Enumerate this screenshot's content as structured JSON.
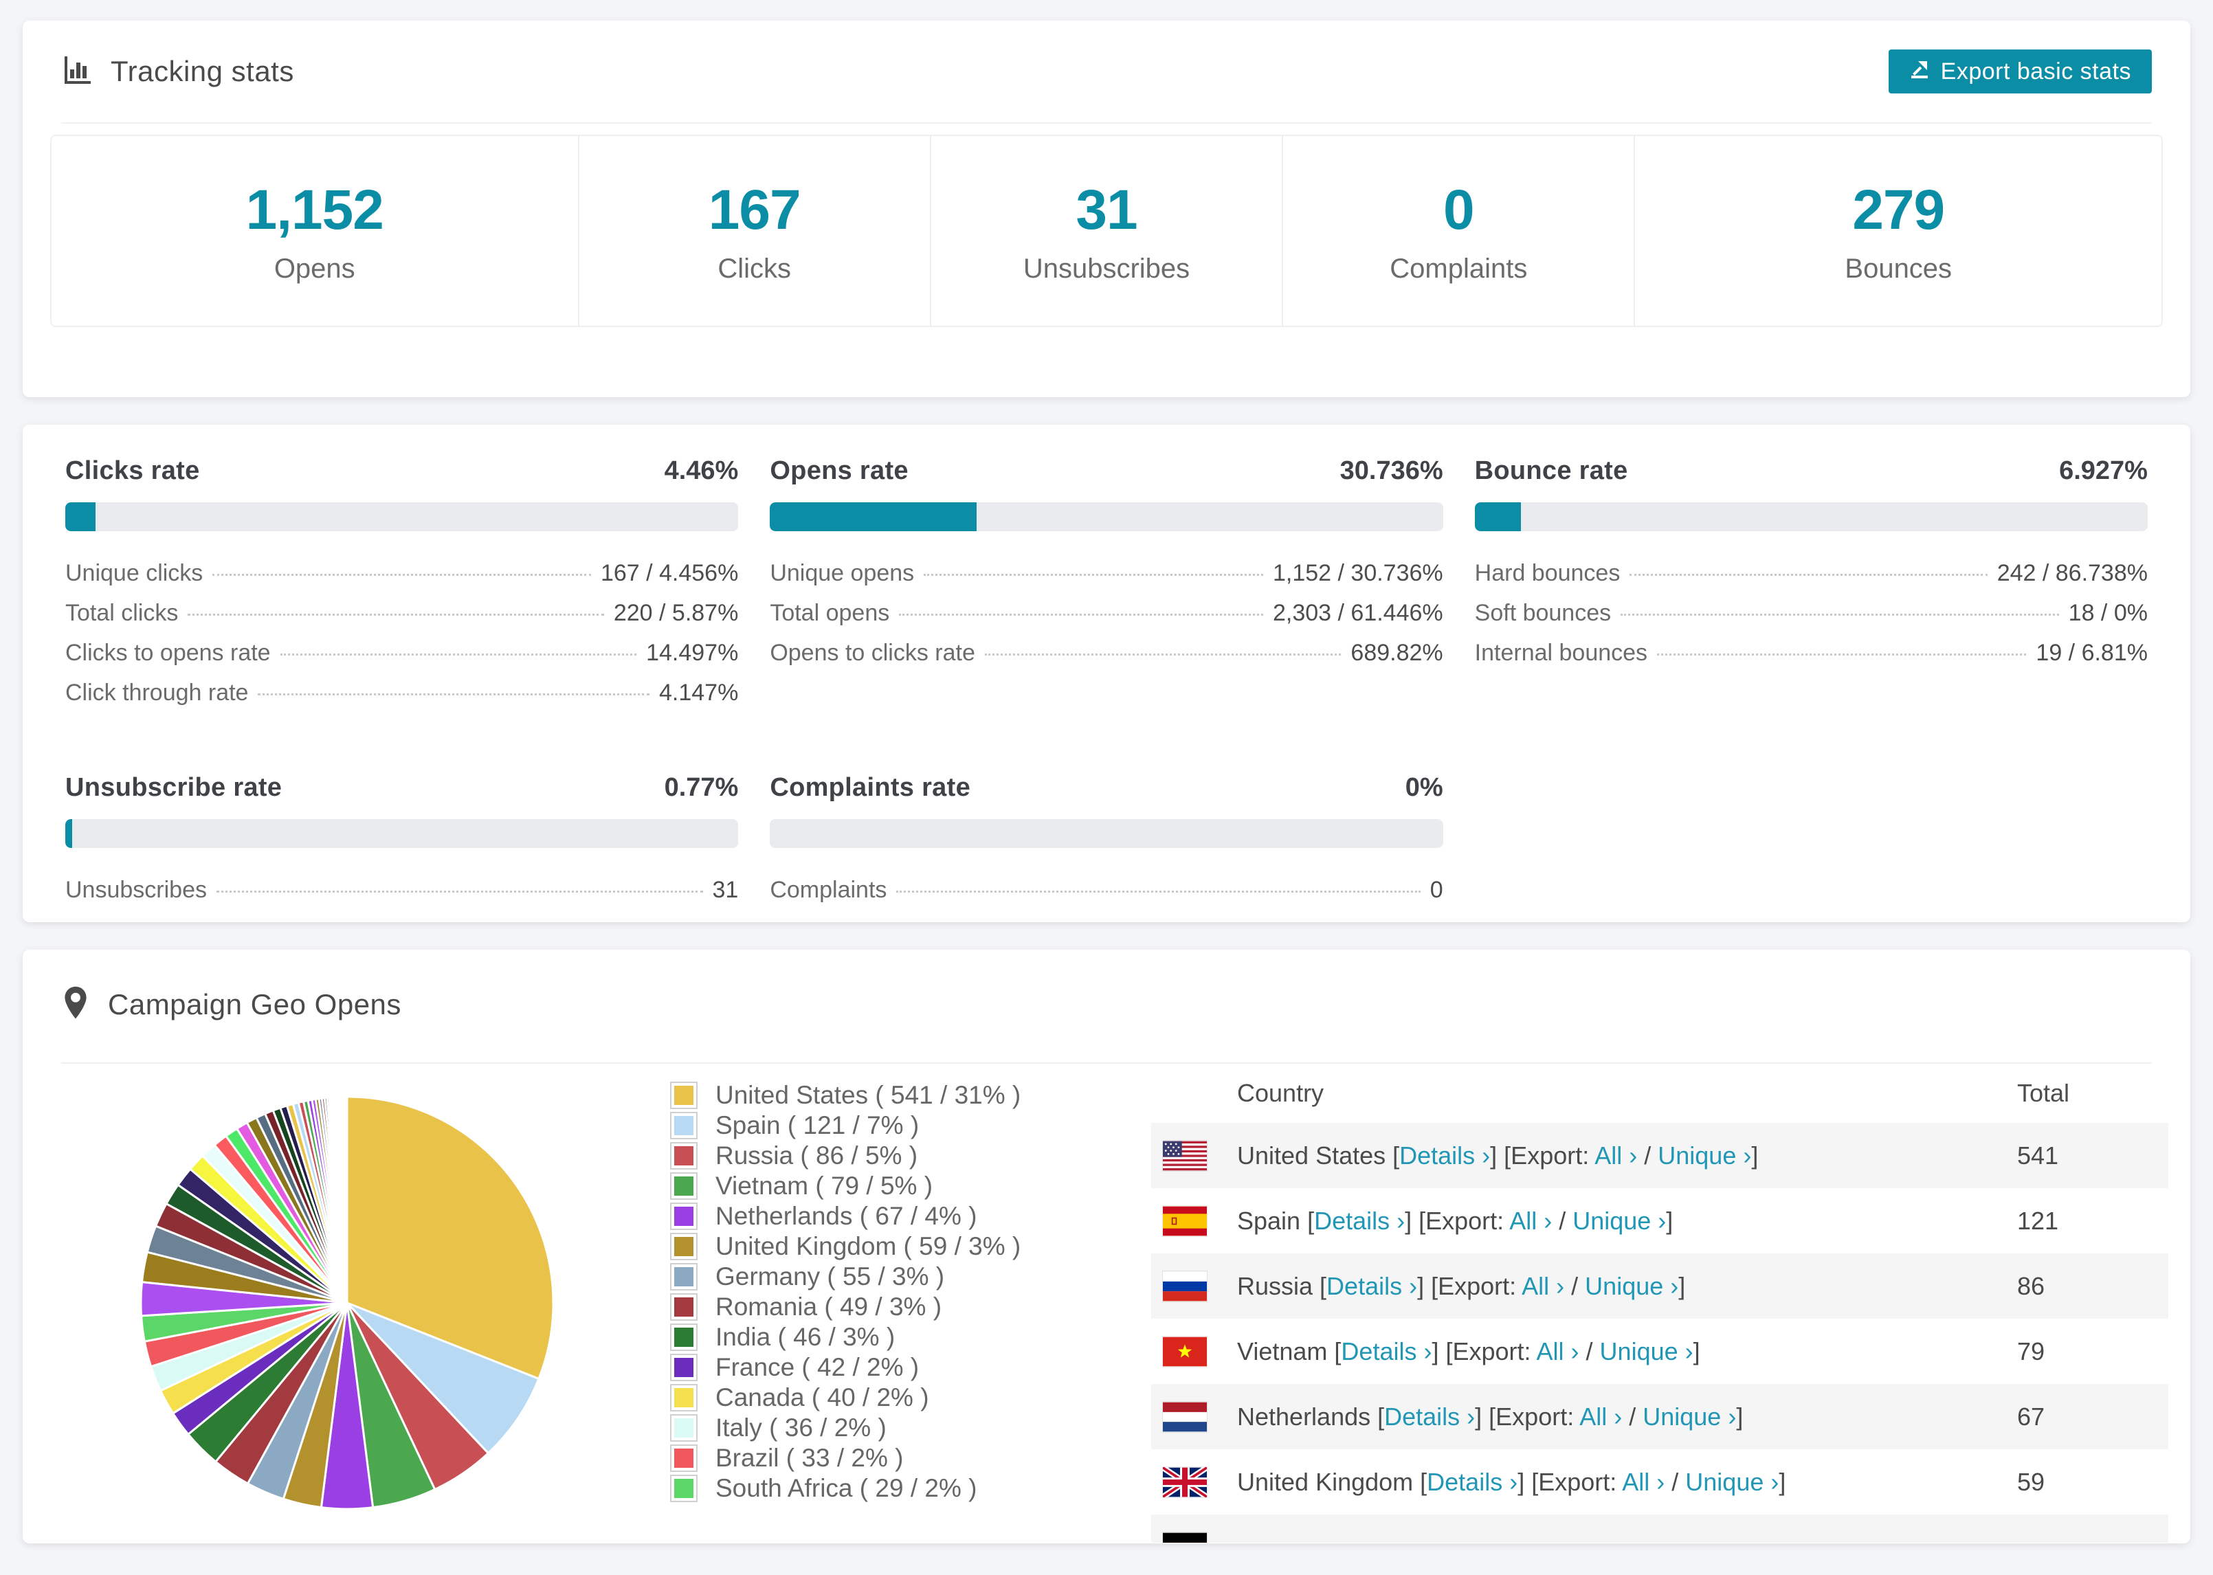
{
  "accent": "#0b8da6",
  "link_color": "#2196b5",
  "header": {
    "title": "Tracking stats",
    "icon": "bar-chart-icon",
    "export_label": "Export basic stats",
    "export_icon": "export-icon"
  },
  "summary": [
    {
      "value": "1,152",
      "label": "Opens"
    },
    {
      "value": "167",
      "label": "Clicks"
    },
    {
      "value": "31",
      "label": "Unsubscribes"
    },
    {
      "value": "0",
      "label": "Complaints"
    },
    {
      "value": "279",
      "label": "Bounces"
    }
  ],
  "rates": {
    "top": [
      {
        "title": "Clicks rate",
        "value": "4.46%",
        "percent": 4.46,
        "rows": [
          {
            "label": "Unique clicks",
            "value": "167 / 4.456%"
          },
          {
            "label": "Total clicks",
            "value": "220 / 5.87%"
          },
          {
            "label": "Clicks to opens rate",
            "value": "14.497%"
          },
          {
            "label": "Click through rate",
            "value": "4.147%"
          }
        ]
      },
      {
        "title": "Opens rate",
        "value": "30.736%",
        "percent": 30.736,
        "rows": [
          {
            "label": "Unique opens",
            "value": "1,152 / 30.736%"
          },
          {
            "label": "Total opens",
            "value": "2,303 / 61.446%"
          },
          {
            "label": "Opens to clicks rate",
            "value": "689.82%"
          }
        ]
      },
      {
        "title": "Bounce rate",
        "value": "6.927%",
        "percent": 6.927,
        "rows": [
          {
            "label": "Hard bounces",
            "value": "242 / 86.738%"
          },
          {
            "label": "Soft bounces",
            "value": "18 / 0%"
          },
          {
            "label": "Internal bounces",
            "value": "19 / 6.81%"
          }
        ]
      }
    ],
    "bottom": [
      {
        "title": "Unsubscribe rate",
        "value": "0.77%",
        "percent": 0.77,
        "rows": [
          {
            "label": "Unsubscribes",
            "value": "31"
          }
        ]
      },
      {
        "title": "Complaints rate",
        "value": "0%",
        "percent": 0,
        "rows": [
          {
            "label": "Complaints",
            "value": "0"
          }
        ]
      }
    ]
  },
  "chart_data": {
    "type": "pie",
    "title": "Campaign Geo Opens",
    "unit": "opens",
    "legend_position": "right",
    "start_angle": "top-clockwise",
    "slices": [
      {
        "label": "United States",
        "value": 541,
        "percent": 31,
        "color": "#e9c24a"
      },
      {
        "label": "Spain",
        "value": 121,
        "percent": 7,
        "color": "#b7d9f3"
      },
      {
        "label": "Russia",
        "value": 86,
        "percent": 5,
        "color": "#c84f54"
      },
      {
        "label": "Vietnam",
        "value": 79,
        "percent": 5,
        "color": "#4ba84f"
      },
      {
        "label": "Netherlands",
        "value": 67,
        "percent": 4,
        "color": "#9a3fe3"
      },
      {
        "label": "United Kingdom",
        "value": 59,
        "percent": 3,
        "color": "#b3922e"
      },
      {
        "label": "Germany",
        "value": 55,
        "percent": 3,
        "color": "#8ca9c4"
      },
      {
        "label": "Romania",
        "value": 49,
        "percent": 3,
        "color": "#a23a40"
      },
      {
        "label": "India",
        "value": 46,
        "percent": 3,
        "color": "#2c7c34"
      },
      {
        "label": "France",
        "value": 42,
        "percent": 2,
        "color": "#6a2dbd"
      },
      {
        "label": "Canada",
        "value": 40,
        "percent": 2,
        "color": "#f6df4d"
      },
      {
        "label": "Italy",
        "value": 36,
        "percent": 2,
        "color": "#dafaf6"
      },
      {
        "label": "Brazil",
        "value": 33,
        "percent": 2,
        "color": "#f1585d"
      },
      {
        "label": "South Africa",
        "value": 29,
        "percent": 2,
        "color": "#5ad766"
      }
    ],
    "others": {
      "percent": 26,
      "count": 50,
      "ratio": 0.9,
      "colors": [
        "#ab4ff0",
        "#9b7d1e",
        "#6e8296",
        "#8e2f36",
        "#1d5c2a",
        "#332565",
        "#f7f63e",
        "#e8fdfc",
        "#fb5a5f",
        "#4ee868",
        "#e35be0",
        "#8a761d",
        "#566d82",
        "#772329",
        "#16441f",
        "#251d4c",
        "#e9c24a",
        "#b7d9f3",
        "#c84f54",
        "#4ba84f",
        "#9a3fe3"
      ]
    }
  },
  "geo": {
    "title": "Campaign Geo Opens",
    "icon": "map-pin-icon",
    "legend_format": {
      "open": "(",
      "slash": "/",
      "close": ")"
    },
    "table": {
      "columns": [
        "Country",
        "Total"
      ],
      "links": {
        "details": "Details ›",
        "export": "Export:",
        "all": "All ›",
        "unique": "Unique ›"
      },
      "tokens": {
        "lb": "[",
        "rb": "]",
        "slash": "/"
      },
      "rows": [
        {
          "flag": "us",
          "country": "United States",
          "total": "541"
        },
        {
          "flag": "es",
          "country": "Spain",
          "total": "121"
        },
        {
          "flag": "ru",
          "country": "Russia",
          "total": "86"
        },
        {
          "flag": "vn",
          "country": "Vietnam",
          "total": "79"
        },
        {
          "flag": "nl",
          "country": "Netherlands",
          "total": "67"
        },
        {
          "flag": "gb",
          "country": "United Kingdom",
          "total": "59"
        },
        {
          "flag": "de",
          "country": "",
          "total": "",
          "partial": true
        }
      ]
    }
  }
}
